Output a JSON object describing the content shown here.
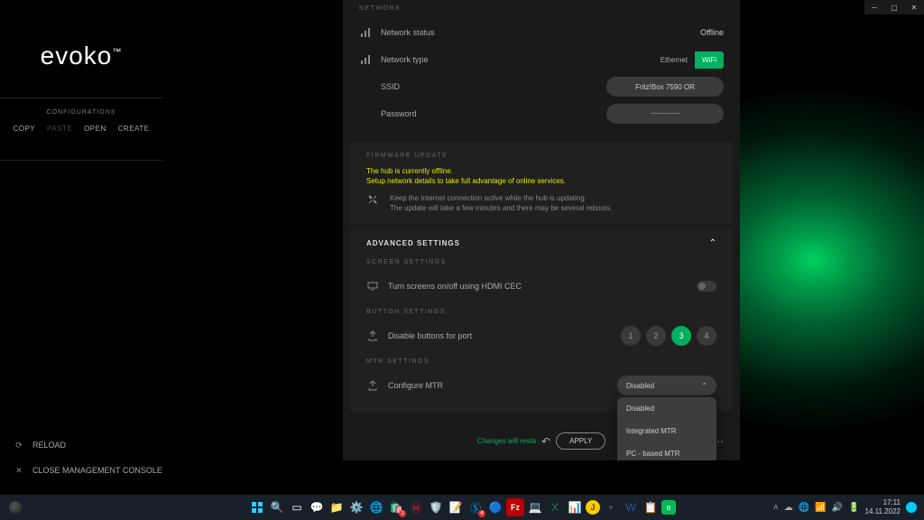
{
  "app_name": "evoko",
  "sidebar": {
    "section_label": "CONFIGURATIONS",
    "actions": {
      "copy": "COPY",
      "paste": "PASTE",
      "open": "OPEN",
      "create": "CREATE"
    },
    "reload": "RELOAD",
    "close": "CLOSE MANAGEMENT CONSOLE"
  },
  "network": {
    "header": "NETWORK",
    "status_label": "Network status",
    "status_value": "Offline",
    "type_label": "Network type",
    "type_options": {
      "ethernet": "Ethernet",
      "wifi": "WiFi"
    },
    "type_selected": "wifi",
    "ssid_label": "SSID",
    "ssid_value": "Fritz!Box 7590 OR",
    "password_label": "Password"
  },
  "firmware": {
    "header": "FIRMWARE UPDATE",
    "warn_line1": "The hub is currently offline.",
    "warn_line2": "Setup network details to take full advantage of online services.",
    "info_line1": "Keep the Internet connection active while the hub is updating.",
    "info_line2": "The update will take a few minutes and there may be several reboots."
  },
  "advanced": {
    "header": "ADVANCED SETTINGS",
    "screen_header": "SCREEN SETTINGS",
    "cec_label": "Turn screens on/off using HDMI CEC",
    "button_header": "BUTTON SETTINGS",
    "disable_label": "Disable buttons for port",
    "ports": [
      "1",
      "2",
      "3",
      "4"
    ],
    "active_port": "3",
    "mtr_header": "MTR SETTINGS",
    "mtr_label": "Configure MTR",
    "mtr_selected": "Disabled",
    "mtr_options": [
      "Disabled",
      "Integrated MTR",
      "PC - based MTR"
    ]
  },
  "footer": {
    "changes_note": "Changes will resta",
    "apply": "APPLY"
  },
  "taskbar": {
    "time": "17:11",
    "date": "14.11.2022"
  }
}
